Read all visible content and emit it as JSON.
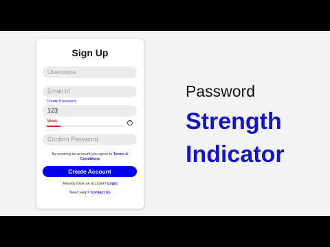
{
  "form": {
    "title": "Sign Up",
    "username_placeholder": "Username",
    "email_placeholder": "Email Id",
    "create_password_label": "Create Password",
    "password_value": "123",
    "strength_label": "Weak",
    "strength_level": 0.18,
    "help_icon": "question-circle-icon",
    "help_glyph": "?",
    "confirm_placeholder": "Confirm Password",
    "terms_prefix": "By creating an account you agree to ",
    "terms_link": "Terms & Conditions",
    "submit_label": "Create Account",
    "login_prefix": "Already have an account? ",
    "login_link": "Login",
    "help_prefix": "Need Help? ",
    "help_link": "Contact Us"
  },
  "headline": {
    "line1": "Password",
    "line2": "Strength",
    "line3": "Indicator"
  },
  "colors": {
    "accent": "#0000ee",
    "weak": "#e02020",
    "headline_blue": "#1515c8"
  }
}
